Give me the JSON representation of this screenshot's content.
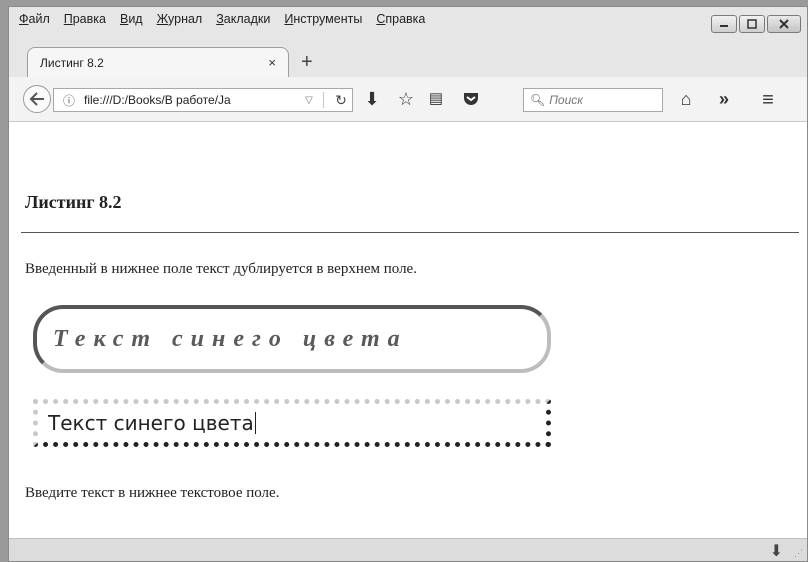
{
  "menu": [
    "Файл",
    "Правка",
    "Вид",
    "Журнал",
    "Закладки",
    "Инструменты",
    "Справка"
  ],
  "menu_underline": [
    "Ф",
    "П",
    "В",
    "Ж",
    "З",
    "И",
    "С"
  ],
  "tab": {
    "title": "Листинг 8.2",
    "close": "×",
    "new": "+"
  },
  "nav": {
    "url": "file:///D:/Books/В работе/Ja",
    "search_placeholder": "Поиск",
    "icons": [
      "back-arrow-icon",
      "info-icon",
      "reload-icon",
      "download-icon",
      "star-icon",
      "reading-list-icon",
      "pocket-icon",
      "search-icon",
      "home-icon",
      "overflow-icon",
      "menu-icon"
    ]
  },
  "page": {
    "heading": "Листинг 8.2",
    "intro": "Введенный в нижнее поле текст дублируется в верхнем поле.",
    "styled_text": "Текст синего цвета",
    "input_value": "Текст синего цвета",
    "hint": "Введите текст в нижнее текстовое поле."
  }
}
